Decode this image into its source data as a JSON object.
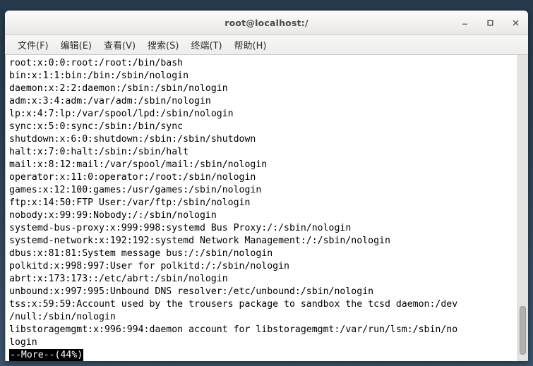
{
  "window": {
    "title": "root@localhost:/",
    "controls": [
      {
        "name": "minimize-button",
        "glyph": "minimize"
      },
      {
        "name": "maximize-button",
        "glyph": "maximize"
      },
      {
        "name": "close-button",
        "glyph": "close"
      }
    ]
  },
  "menubar": {
    "items": [
      {
        "label": "文件(F)",
        "name": "menu-file"
      },
      {
        "label": "编辑(E)",
        "name": "menu-edit"
      },
      {
        "label": "查看(V)",
        "name": "menu-view"
      },
      {
        "label": "搜索(S)",
        "name": "menu-search"
      },
      {
        "label": "终端(T)",
        "name": "menu-terminal"
      },
      {
        "label": "帮助(H)",
        "name": "menu-help"
      }
    ]
  },
  "terminal": {
    "lines": [
      "root:x:0:0:root:/root:/bin/bash",
      "bin:x:1:1:bin:/bin:/sbin/nologin",
      "daemon:x:2:2:daemon:/sbin:/sbin/nologin",
      "adm:x:3:4:adm:/var/adm:/sbin/nologin",
      "lp:x:4:7:lp:/var/spool/lpd:/sbin/nologin",
      "sync:x:5:0:sync:/sbin:/bin/sync",
      "shutdown:x:6:0:shutdown:/sbin:/sbin/shutdown",
      "halt:x:7:0:halt:/sbin:/sbin/halt",
      "mail:x:8:12:mail:/var/spool/mail:/sbin/nologin",
      "operator:x:11:0:operator:/root:/sbin/nologin",
      "games:x:12:100:games:/usr/games:/sbin/nologin",
      "ftp:x:14:50:FTP User:/var/ftp:/sbin/nologin",
      "nobody:x:99:99:Nobody:/:/sbin/nologin",
      "systemd-bus-proxy:x:999:998:systemd Bus Proxy:/:/sbin/nologin",
      "systemd-network:x:192:192:systemd Network Management:/:/sbin/nologin",
      "dbus:x:81:81:System message bus:/:/sbin/nologin",
      "polkitd:x:998:997:User for polkitd:/:/sbin/nologin",
      "abrt:x:173:173::/etc/abrt:/sbin/nologin",
      "unbound:x:997:995:Unbound DNS resolver:/etc/unbound:/sbin/nologin",
      "tss:x:59:59:Account used by the trousers package to sandbox the tcsd daemon:/dev",
      "/null:/sbin/nologin",
      "libstoragemgmt:x:996:994:daemon account for libstoragemgmt:/var/run/lsm:/sbin/no",
      "login"
    ],
    "pager_prompt": "--More--(44%)"
  },
  "scrollbar": {
    "thumb_top_pct": 82,
    "thumb_height_pct": 16
  },
  "colors": {
    "desktop": "#2b4257",
    "titlebar": "#f2f1f0",
    "terminal_bg": "#ffffff",
    "terminal_fg": "#000000",
    "pager_bg": "#000000",
    "pager_fg": "#ffffff"
  }
}
